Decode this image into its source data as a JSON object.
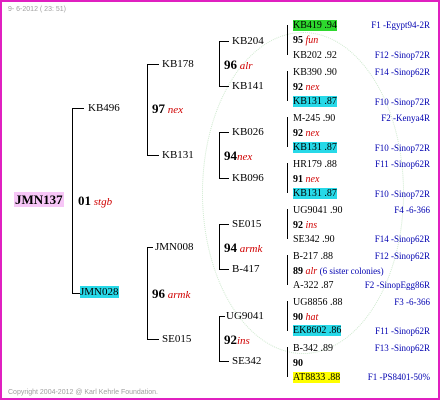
{
  "header": "9- 6-2012 ( 23: 51)",
  "footer": "Copyright 2004-2012 @ Karl Kehrle Foundation.",
  "root": {
    "name": "JMN137",
    "num": "01",
    "tag": "stgb"
  },
  "gen1": [
    {
      "name": "KB496"
    },
    {
      "name": "JMN028",
      "num": "96",
      "tag": "armk"
    }
  ],
  "gen1_parent": {
    "num": "97",
    "tag": "nex"
  },
  "gen2": [
    {
      "name": "KB178",
      "num": "96",
      "tag": "alr"
    },
    {
      "name": "KB131",
      "num": "94",
      "tag": "nex"
    },
    {
      "name": "JMN008",
      "num": "94",
      "tag": "armk"
    },
    {
      "name": "SE015",
      "num": "92",
      "tag": "ins"
    }
  ],
  "gen3": [
    {
      "name": "KB204"
    },
    {
      "name": "KB141"
    },
    {
      "name": "KB026"
    },
    {
      "name": "KB096"
    },
    {
      "name": "SE015"
    },
    {
      "name": "B-417"
    },
    {
      "name": "UG9041"
    },
    {
      "name": "SE342"
    }
  ],
  "gen4": [
    {
      "a": "KB419 .94",
      "ref": "F1 -Egypt94-2R"
    },
    {
      "a": "95",
      "b": "fun"
    },
    {
      "a": "KB202 .92",
      "ref": "F12 -Sinop72R"
    },
    {
      "a": "KB390 .90",
      "ref": "F14 -Sinop62R"
    },
    {
      "a": "92",
      "b": "nex"
    },
    {
      "a": "KB131 .87",
      "ref": "F10 -Sinop72R"
    },
    {
      "a": "M-245 .90",
      "ref": "F2 -Kenya4R"
    },
    {
      "a": "92",
      "b": "nex"
    },
    {
      "a": "KB131 .87",
      "ref": "F10 -Sinop72R"
    },
    {
      "a": "HR179 .88",
      "ref": "F11 -Sinop62R"
    },
    {
      "a": "91",
      "b": "nex"
    },
    {
      "a": "KB131 .87",
      "ref": "F10 -Sinop72R"
    },
    {
      "a": "UG9041 .90",
      "ref": "F4 -6-366"
    },
    {
      "a": "92",
      "b": "ins"
    },
    {
      "a": "SE342 .90",
      "ref": "F14 -Sinop62R"
    },
    {
      "a": "B-217 .88",
      "ref": "F12 -Sinop62R"
    },
    {
      "a": "89",
      "b": "alr",
      "note": "(6 sister colonies)"
    },
    {
      "a": "A-322 .87",
      "ref": "F2 -SinopEgg86R"
    },
    {
      "a": "UG8856 .88",
      "ref": "F3 -6-366"
    },
    {
      "a": "90",
      "b": "hat"
    },
    {
      "a": "EK8602 .86",
      "ref": "F11 -Sinop62R"
    },
    {
      "a": "B-342 .89",
      "ref": "F13 -Sinop62R"
    },
    {
      "a": "90"
    },
    {
      "a": "AT8833 .88",
      "ref": "F1 -PS8401-50%"
    }
  ],
  "colors": {
    "border": "#e020c0",
    "pink": "#f7c6f7",
    "cyan": "#27d9e8",
    "green": "#2ed82e",
    "yellow": "#ffff00",
    "ref_text": "#0000b0",
    "tag_text": "#d00000"
  }
}
